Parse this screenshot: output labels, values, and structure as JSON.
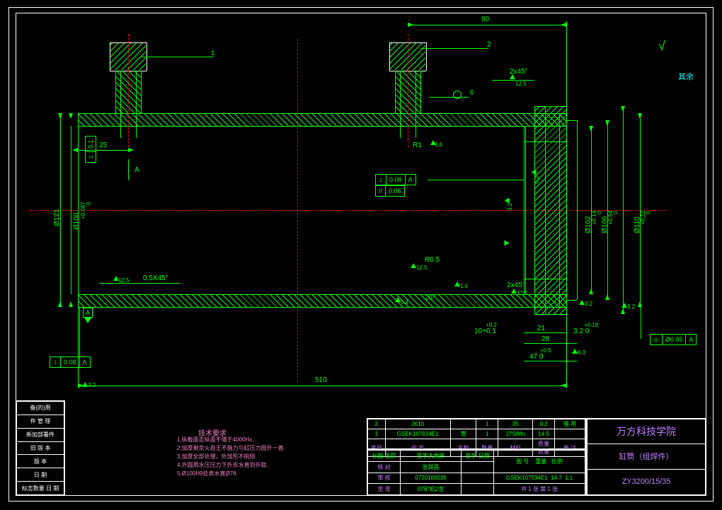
{
  "drawing": {
    "dims": {
      "d80": "80",
      "d25": "25",
      "d510": "510",
      "d47": "47",
      "d28": "28",
      "d21": "21",
      "d10": "10",
      "d3_2": "3.2",
      "d2x45_1": "2x45°",
      "d2x45_2": "2x45°",
      "d0_5x45": "0.5X45°",
      "c0_08": "0.08",
      "c0_06": "0.06",
      "phi121": "Ø121",
      "phi100": "Ø100",
      "phi100tol_u": "+0.087",
      "phi100tol_l": "0",
      "phi102": "Ø102",
      "phi102tol_u": "+0.14",
      "phi102tol_l": "0",
      "phi106": "Ø106",
      "phi106tol_u": "+0.54",
      "phi106tol_l": "0",
      "phi110": "Ø110",
      "phi110tol_u": "+0.22",
      "phi110tol_l": "0",
      "r1": "R1",
      "r0_5": "R0.5",
      "a20": "20°",
      "weld6": "6",
      "tol47_u": "+0.5",
      "tol47_l": "0",
      "tol10_u": "+0.2",
      "tol10_l": "+0.1",
      "tol3_2_u": "+0.18",
      "tol3_2_l": "0",
      "gdt1": "0.08",
      "gdt2": "0.08",
      "gdt3": "0.06",
      "gdt_circ": "Ø0.05",
      "gdt_datum": "A",
      "datumA": "A",
      "lbl1": "1",
      "lbl2": "2",
      "sectionA": "A",
      "vtol": "0.1"
    },
    "surf": {
      "s1_6": "1.6",
      "s3_2": "3.2",
      "s12_5": "12.5",
      "s0_4": "0.4"
    },
    "notes": {
      "t": "技术要求",
      "n1": "1.纵截面走纵面不储于4000Hx.",
      "n2": "2.加厚剩余火自王不施力与缸压力图外一直.",
      "n3": "3.加厚全部处理，外加形不削除.",
      "n4": "4.外圆用水压压力下外去水直到外取.",
      "n5": "5.Ø100H9处表水直Ø78."
    },
    "rest": "其余"
  },
  "bom": {
    "r2": {
      "no": "2",
      "code": "JK10",
      "name": "",
      "qty": "1",
      "mat": "35",
      "wt": "0.2",
      "note": "借 用"
    },
    "r1": {
      "no": "1",
      "code": "GSEK107034E1",
      "name": "筒",
      "qty": "1",
      "mat": "27SIMn",
      "wt": "14.5",
      "note": ""
    },
    "h": {
      "no": "序号",
      "code": "代 号",
      "name": "名称",
      "qty": "数量",
      "mat": "材料",
      "wt": "质量 质量",
      "note": "备 注"
    }
  },
  "tb": {
    "org": "万方科技学院",
    "part": "缸筒（组焊件）",
    "dwgno": "ZY3200/15/35",
    "dwgcode": "GSEK107034E1",
    "scale_l": "比例",
    "scale_v": "1:1",
    "wt_l": "重量",
    "wt_v": "14.7",
    "sheet": "共 1 张    第 1 张",
    "r_design_l": "标图 张熙",
    "r_date": "签字 日期",
    "r_design2": "签字大角件",
    "r_check_l": "核 对",
    "r_name1": "张其昌",
    "r_app_l": "审 核",
    "r_id1": "0720160035",
    "r_std_l": "金 准",
    "r_id2": "07矿机2金",
    "num_l": "图 号"
  },
  "leftblock": {
    "r1a": "备(的)用",
    "r1b": "件 管 理",
    "r2": "新加部署件",
    "r3": "旧 版 本",
    "r4": "版 本",
    "r5": "日 期",
    "r6": "标志数量",
    "r6b": "日 期"
  }
}
